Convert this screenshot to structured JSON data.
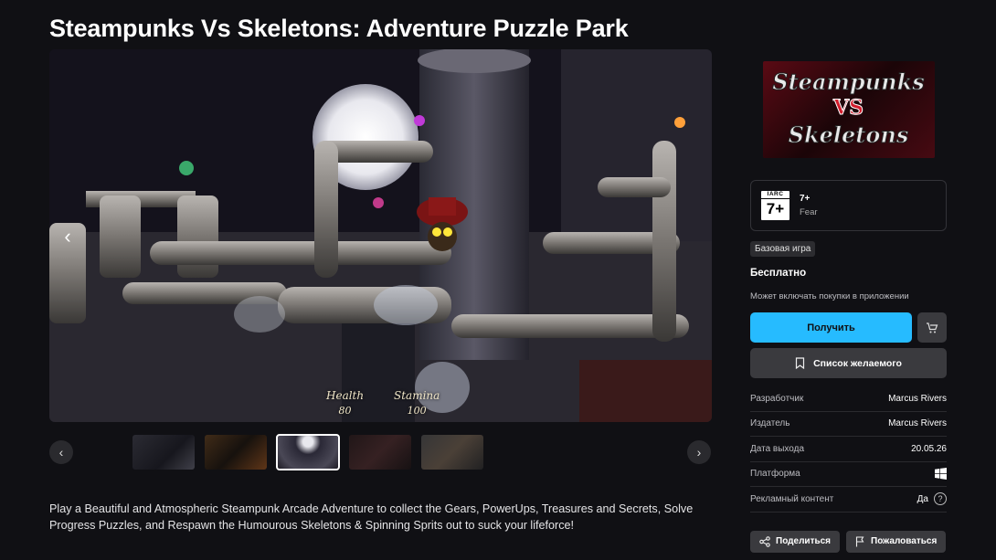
{
  "game": {
    "title": "Steampunks Vs Skeletons: Adventure Puzzle Park",
    "description": "Play a Beautiful and Atmospheric Steampunk Arcade Adventure to collect the Gears, PowerUps, Treasures and Secrets, Solve Progress Puzzles, and Respawn the Humourous Skeletons & Spinning Sprits out to suck your lifeforce!"
  },
  "media": {
    "hud": {
      "health_label": "Health",
      "health_value": "80",
      "stamina_label": "Stamina",
      "stamina_value": "100"
    },
    "thumbnails_count": 5,
    "active_thumbnail": 3
  },
  "logo": {
    "line1": "Steampunks",
    "line2": "VS",
    "line3": "Skeletons"
  },
  "rating": {
    "board": "IARC",
    "age": "7+",
    "descriptor": "Fear"
  },
  "purchase": {
    "badge": "Базовая игра",
    "price": "Бесплатно",
    "iap_note": "Может включать покупки в приложении",
    "get_label": "Получить",
    "wishlist_label": "Список желаемого"
  },
  "details": [
    {
      "key": "Разработчик",
      "value": "Marcus Rivers"
    },
    {
      "key": "Издатель",
      "value": "Marcus Rivers"
    },
    {
      "key": "Дата выхода",
      "value": "20.05.26"
    },
    {
      "key": "Платформа",
      "value": ""
    },
    {
      "key": "Рекламный контент",
      "value": "Да"
    }
  ],
  "actions": {
    "share_label": "Поделиться",
    "report_label": "Пожаловаться"
  },
  "icons": {
    "platform": "windows-icon",
    "help": "question-icon",
    "cart": "cart-add-icon",
    "wishlist": "bookmark-icon",
    "share": "share-icon",
    "report": "flag-icon"
  },
  "colors": {
    "background": "#101014",
    "accent": "#26bbff",
    "button": "#3a3a3e"
  }
}
